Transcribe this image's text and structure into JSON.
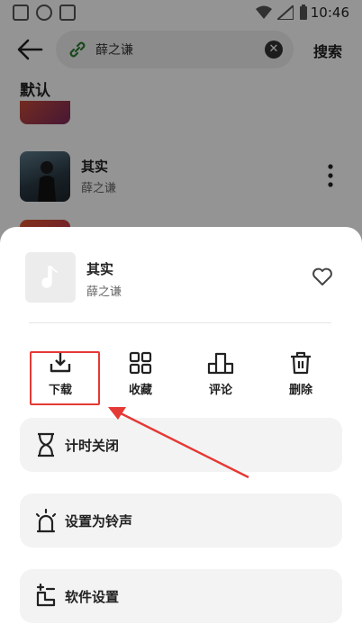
{
  "status_bar": {
    "time": "10:46"
  },
  "search": {
    "query": "薛之谦",
    "button_label": "搜索"
  },
  "tabs": {
    "default_label": "默认"
  },
  "song_list": [
    {
      "title": "其实",
      "artist": "薛之谦"
    }
  ],
  "sheet": {
    "song_title": "其实",
    "song_artist": "薛之谦",
    "actions": [
      {
        "label": "下载",
        "icon": "download-icon"
      },
      {
        "label": "收藏",
        "icon": "grid-icon"
      },
      {
        "label": "评论",
        "icon": "podium-icon"
      },
      {
        "label": "删除",
        "icon": "trash-icon"
      }
    ],
    "rows": [
      {
        "label": "计时关闭",
        "icon": "hourglass-icon"
      },
      {
        "label": "设置为铃声",
        "icon": "alarm-icon"
      },
      {
        "label": "软件设置",
        "icon": "settings-icon"
      }
    ]
  },
  "colors": {
    "accent": "#2d6bd8",
    "annotation_red": "#e53935",
    "dim_overlay": "rgba(0,0,0,0.42)"
  }
}
